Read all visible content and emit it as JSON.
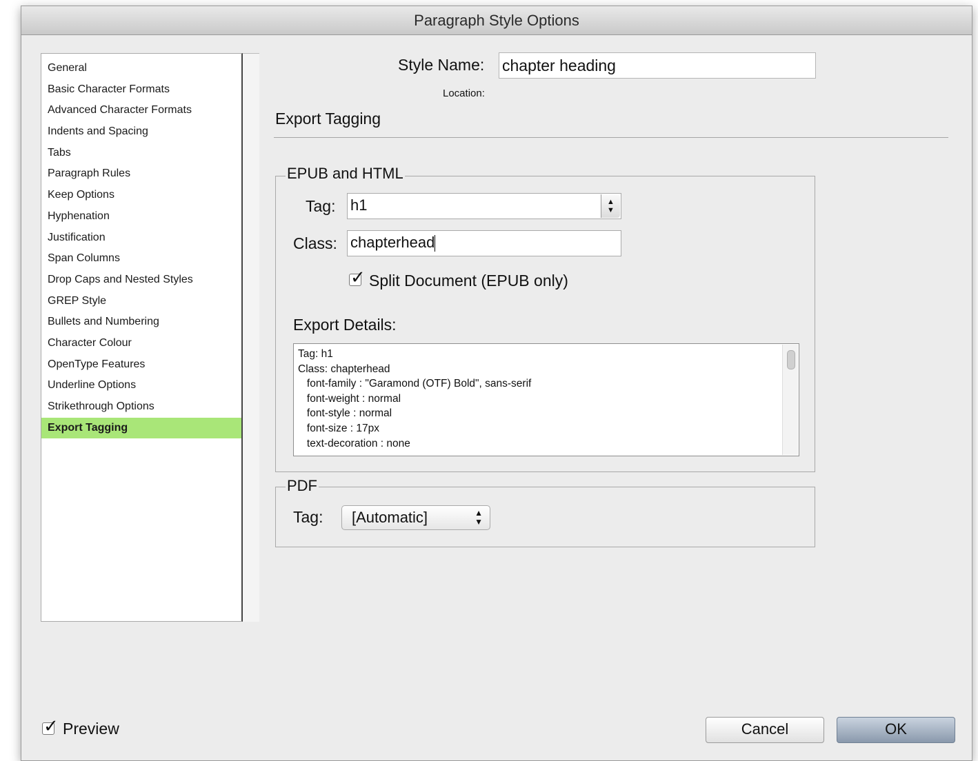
{
  "window": {
    "title": "Paragraph Style Options"
  },
  "sidebar": {
    "items": [
      {
        "label": "General"
      },
      {
        "label": "Basic Character Formats"
      },
      {
        "label": "Advanced Character Formats"
      },
      {
        "label": "Indents and Spacing"
      },
      {
        "label": "Tabs"
      },
      {
        "label": "Paragraph Rules"
      },
      {
        "label": "Keep Options"
      },
      {
        "label": "Hyphenation"
      },
      {
        "label": "Justification"
      },
      {
        "label": "Span Columns"
      },
      {
        "label": "Drop Caps and Nested Styles"
      },
      {
        "label": "GREP Style"
      },
      {
        "label": "Bullets and Numbering"
      },
      {
        "label": "Character Colour"
      },
      {
        "label": "OpenType Features"
      },
      {
        "label": "Underline Options"
      },
      {
        "label": "Strikethrough Options"
      },
      {
        "label": "Export Tagging"
      }
    ],
    "selected_label": "Export Tagging",
    "selected_color": "#a9e678"
  },
  "header": {
    "style_name_label": "Style Name:",
    "style_name_value": "chapter heading",
    "location_label": "Location:",
    "section_title": "Export Tagging"
  },
  "epub": {
    "group_title": "EPUB and HTML",
    "tag_label": "Tag:",
    "tag_value": "h1",
    "class_label": "Class:",
    "class_value": "chapterhead",
    "split_label": "Split Document (EPUB only)",
    "split_checked": true,
    "details_label": "Export Details:",
    "details_lines": [
      "Tag: h1",
      "Class: chapterhead",
      "   font-family : \"Garamond (OTF) Bold\", sans-serif",
      "   font-weight : normal",
      "   font-style : normal",
      "   font-size : 17px",
      "   text-decoration : none"
    ]
  },
  "pdf": {
    "group_title": "PDF",
    "tag_label": "Tag:",
    "tag_value": "[Automatic]"
  },
  "footer": {
    "preview_label": "Preview",
    "preview_checked": true,
    "cancel_label": "Cancel",
    "ok_label": "OK"
  },
  "icons": {
    "checkmark": "checkmark-icon",
    "stepper": "stepper-arrows-icon",
    "popup_arrows": "popup-arrows-icon"
  }
}
